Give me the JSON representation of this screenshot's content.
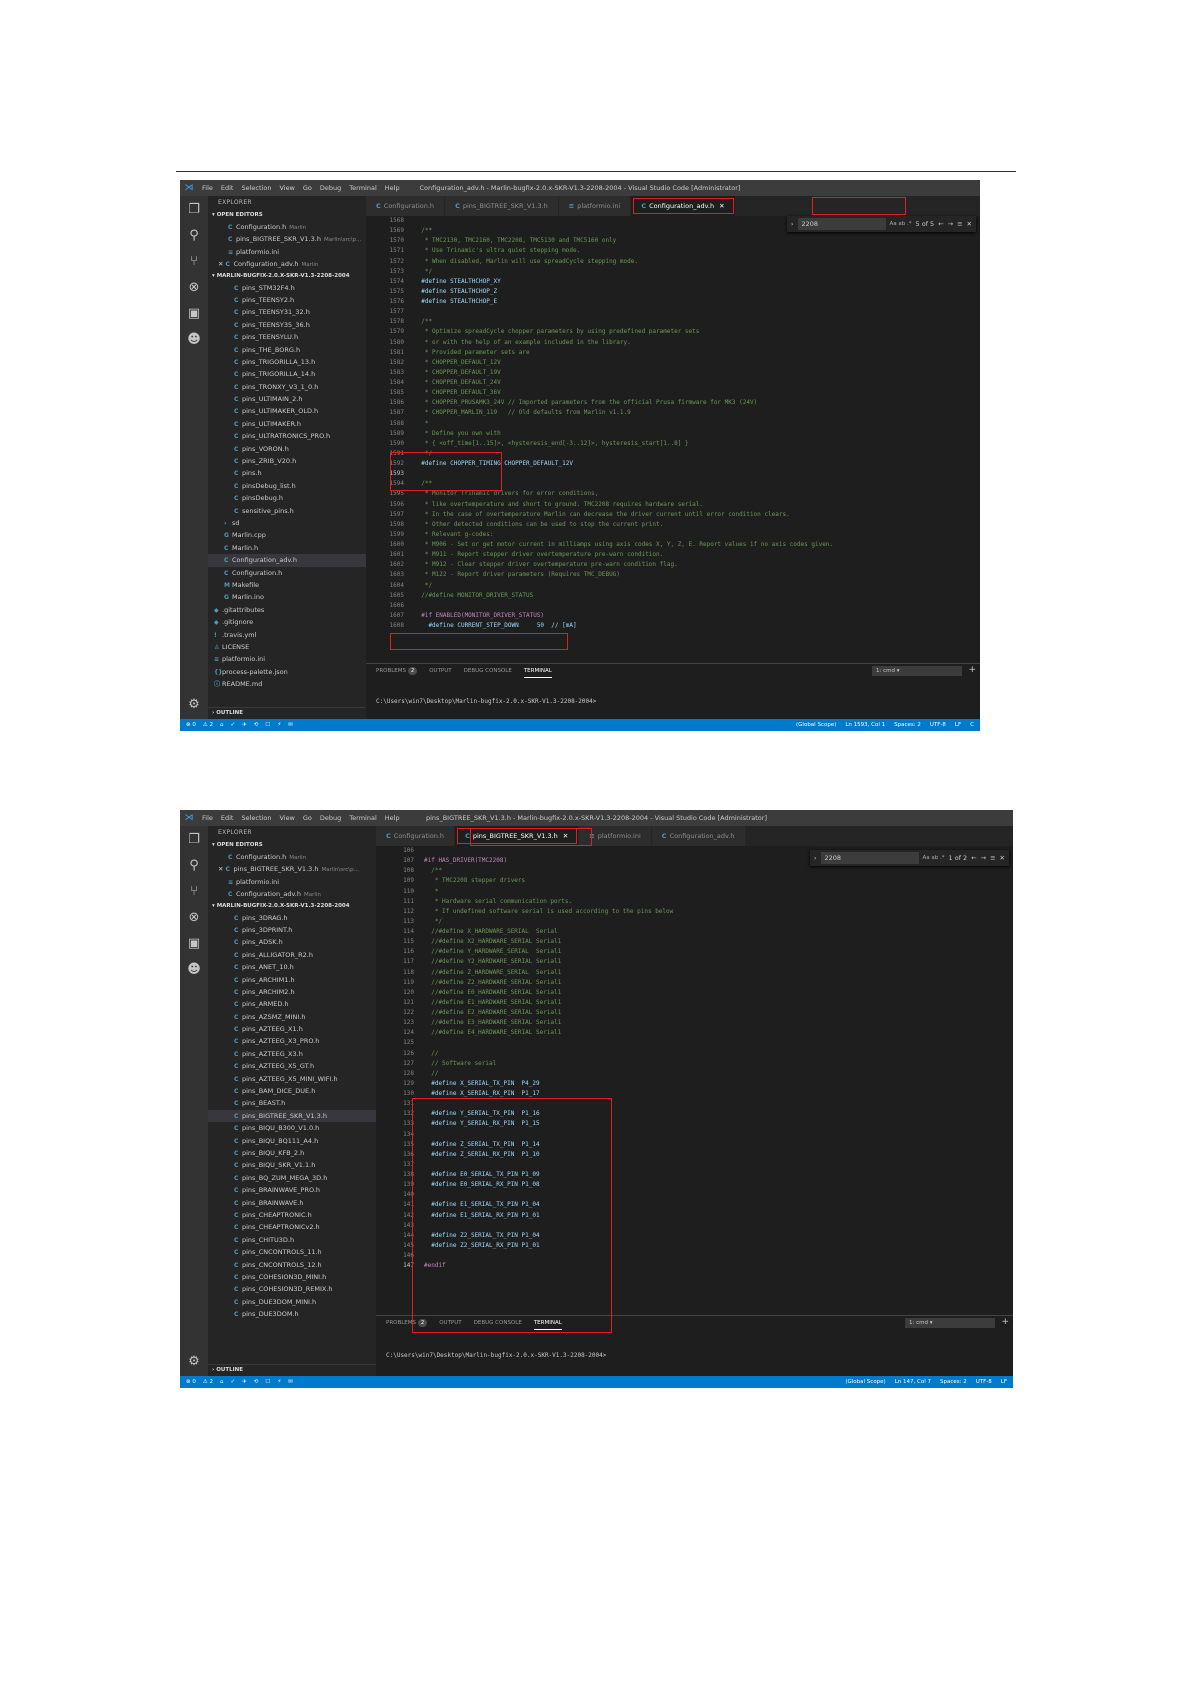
{
  "common": {
    "menu": [
      "File",
      "Edit",
      "Selection",
      "View",
      "Go",
      "Debug",
      "Terminal",
      "Help"
    ],
    "explorer_title": "EXPLORER",
    "open_editors_label": "OPEN EDITORS",
    "workspace_label": "MARLIN-BUGFIX-2.0.X-SKR-V1.3-2208-2004",
    "outline_label": "OUTLINE",
    "panel_tabs": [
      "PROBLEMS",
      "OUTPUT",
      "DEBUG CONSOLE",
      "TERMINAL"
    ],
    "problems_count": "2",
    "terminal_select": "1: cmd",
    "status_left": [
      "⊗ 0",
      "⚠ 2"
    ],
    "accent": "#007acc",
    "highlight_color": "#e02020"
  },
  "shot1": {
    "window_title": "Configuration_adv.h - Marlin-bugfix-2.0.x-SKR-V1.3-2208-2004 - Visual Studio Code [Administrator]",
    "tabs": [
      {
        "icon": "C",
        "label": "Configuration.h"
      },
      {
        "icon": "C",
        "label": "pins_BIGTREE_SKR_V1.3.h"
      },
      {
        "icon": "≡",
        "label": "platformio.ini"
      },
      {
        "icon": "C",
        "label": "Configuration_adv.h",
        "active": true
      }
    ],
    "open_editors": [
      {
        "icon": "C",
        "name": "Configuration.h",
        "hint": "Marlin"
      },
      {
        "icon": "C",
        "name": "pins_BIGTREE_SKR_V1.3.h",
        "hint": "Marlin\\src\\p..."
      },
      {
        "icon": "≡",
        "name": "platformio.ini",
        "hint": ""
      },
      {
        "icon": "C",
        "name": "Configuration_adv.h",
        "hint": "Marlin",
        "close": true
      }
    ],
    "files": [
      {
        "icon": "C",
        "name": "pins_STM32F4.h",
        "indent": 2
      },
      {
        "icon": "C",
        "name": "pins_TEENSY2.h",
        "indent": 2
      },
      {
        "icon": "C",
        "name": "pins_TEENSY31_32.h",
        "indent": 2
      },
      {
        "icon": "C",
        "name": "pins_TEENSY35_36.h",
        "indent": 2
      },
      {
        "icon": "C",
        "name": "pins_TEENSYLU.h",
        "indent": 2
      },
      {
        "icon": "C",
        "name": "pins_THE_BORG.h",
        "indent": 2
      },
      {
        "icon": "C",
        "name": "pins_TRIGORILLA_13.h",
        "indent": 2
      },
      {
        "icon": "C",
        "name": "pins_TRIGORILLA_14.h",
        "indent": 2
      },
      {
        "icon": "C",
        "name": "pins_TRONXY_V3_1_0.h",
        "indent": 2
      },
      {
        "icon": "C",
        "name": "pins_ULTIMAIN_2.h",
        "indent": 2
      },
      {
        "icon": "C",
        "name": "pins_ULTIMAKER_OLD.h",
        "indent": 2
      },
      {
        "icon": "C",
        "name": "pins_ULTIMAKER.h",
        "indent": 2
      },
      {
        "icon": "C",
        "name": "pins_ULTRATRONICS_PRO.h",
        "indent": 2
      },
      {
        "icon": "C",
        "name": "pins_VORON.h",
        "indent": 2
      },
      {
        "icon": "C",
        "name": "pins_ZRIB_V20.h",
        "indent": 2
      },
      {
        "icon": "C",
        "name": "pins.h",
        "indent": 2
      },
      {
        "icon": "C",
        "name": "pinsDebug_list.h",
        "indent": 2
      },
      {
        "icon": "C",
        "name": "pinsDebug.h",
        "indent": 2
      },
      {
        "icon": "C",
        "name": "sensitive_pins.h",
        "indent": 2
      },
      {
        "icon": "›",
        "name": "sd",
        "indent": 1
      },
      {
        "icon": "G",
        "name": "Marlin.cpp",
        "indent": 1
      },
      {
        "icon": "C",
        "name": "Marlin.h",
        "indent": 1
      },
      {
        "icon": "C",
        "name": "Configuration_adv.h",
        "indent": 1,
        "sel": true
      },
      {
        "icon": "C",
        "name": "Configuration.h",
        "indent": 1
      },
      {
        "icon": "M",
        "name": "Makefile",
        "indent": 1
      },
      {
        "icon": "G",
        "name": "Marlin.ino",
        "indent": 1
      },
      {
        "icon": "◆",
        "name": ".gitattributes",
        "indent": 0
      },
      {
        "icon": "◆",
        "name": ".gitignore",
        "indent": 0
      },
      {
        "icon": "!",
        "name": ".travis.yml",
        "indent": 0
      },
      {
        "icon": "♙",
        "name": "LICENSE",
        "indent": 0
      },
      {
        "icon": "≡",
        "name": "platformio.ini",
        "indent": 0
      },
      {
        "icon": "{}",
        "name": "process-palette.json",
        "indent": 0
      },
      {
        "icon": "ⓘ",
        "name": "README.md",
        "indent": 0
      }
    ],
    "find": {
      "value": "2208",
      "result": "5 of 5",
      "opts": "Aa  ab  .*"
    },
    "code": [
      {
        "n": "1568",
        "t": ""
      },
      {
        "n": "1569",
        "t": "  /**"
      },
      {
        "n": "1570",
        "t": "   * TMC2130, TMC2160, TMC2208, TMC5130 and TMC5160 only"
      },
      {
        "n": "1571",
        "t": "   * Use Trinamic's ultra quiet stepping mode."
      },
      {
        "n": "1572",
        "t": "   * When disabled, Marlin will use spreadCycle stepping mode."
      },
      {
        "n": "1573",
        "t": "   */"
      },
      {
        "n": "1574",
        "t": "  #define STEALTHCHOP_XY",
        "k": "def"
      },
      {
        "n": "1575",
        "t": "  #define STEALTHCHOP_Z",
        "k": "def"
      },
      {
        "n": "1576",
        "t": "  #define STEALTHCHOP_E",
        "k": "def"
      },
      {
        "n": "1577",
        "t": ""
      },
      {
        "n": "1578",
        "t": "  /**"
      },
      {
        "n": "1579",
        "t": "   * Optimize spreadCycle chopper parameters by using predefined parameter sets"
      },
      {
        "n": "1580",
        "t": "   * or with the help of an example included in the library."
      },
      {
        "n": "1581",
        "t": "   * Provided parameter sets are"
      },
      {
        "n": "1582",
        "t": "   * CHOPPER_DEFAULT_12V"
      },
      {
        "n": "1583",
        "t": "   * CHOPPER_DEFAULT_19V"
      },
      {
        "n": "1584",
        "t": "   * CHOPPER_DEFAULT_24V"
      },
      {
        "n": "1585",
        "t": "   * CHOPPER_DEFAULT_36V"
      },
      {
        "n": "1586",
        "t": "   * CHOPPER_PRUSAMK3_24V // Imported parameters from the official Prusa firmware for MK3 (24V)"
      },
      {
        "n": "1587",
        "t": "   * CHOPPER_MARLIN_119   // Old defaults from Marlin v1.1.9"
      },
      {
        "n": "1588",
        "t": "   *"
      },
      {
        "n": "1589",
        "t": "   * Define you own with"
      },
      {
        "n": "1590",
        "t": "   * { <off_time[1..15]>, <hysteresis_end[-3..12]>, hysteresis_start[1..8] }"
      },
      {
        "n": "1591",
        "t": "   */"
      },
      {
        "n": "1592",
        "t": "  #define CHOPPER_TIMING CHOPPER_DEFAULT_12V",
        "k": "def"
      },
      {
        "n": "1593",
        "t": "",
        "cur": true
      },
      {
        "n": "1594",
        "t": "  /**"
      },
      {
        "n": "1595",
        "t": "   * Monitor Trinamic drivers for error conditions,"
      },
      {
        "n": "1596",
        "t": "   * like overtemperature and short to ground. TMC2208 requires hardware serial."
      },
      {
        "n": "1597",
        "t": "   * In the case of overtemperature Marlin can decrease the driver current until error condition clears."
      },
      {
        "n": "1598",
        "t": "   * Other detected conditions can be used to stop the current print."
      },
      {
        "n": "1599",
        "t": "   * Relevant g-codes:"
      },
      {
        "n": "1600",
        "t": "   * M906 - Set or get motor current in milliamps using axis codes X, Y, Z, E. Report values if no axis codes given."
      },
      {
        "n": "1601",
        "t": "   * M911 - Report stepper driver overtemperature pre-warn condition."
      },
      {
        "n": "1602",
        "t": "   * M912 - Clear stepper driver overtemperature pre-warn condition flag."
      },
      {
        "n": "1603",
        "t": "   * M122 - Report driver parameters (Requires TMC_DEBUG)"
      },
      {
        "n": "1604",
        "t": "   */"
      },
      {
        "n": "1605",
        "t": "  //#define MONITOR_DRIVER_STATUS"
      },
      {
        "n": "1606",
        "t": ""
      },
      {
        "n": "1607",
        "t": "  #if ENABLED(MONITOR_DRIVER_STATUS)",
        "k": "pp"
      },
      {
        "n": "1608",
        "t": "    #define CURRENT_STEP_DOWN     50  // [mA]",
        "k": "def"
      }
    ],
    "terminal_line": "C:\\Users\\win7\\Desktop\\Marlin-bugfix-2.0.x-SKR-V1.3-2208-2004>",
    "status_right": [
      "(Global Scope)",
      "Ln 1593, Col 1",
      "Spaces: 2",
      "UTF-8",
      "LF",
      "C"
    ]
  },
  "shot2": {
    "window_title": "pins_BIGTREE_SKR_V1.3.h - Marlin-bugfix-2.0.x-SKR-V1.3-2208-2004 - Visual Studio Code [Administrator]",
    "tabs": [
      {
        "icon": "C",
        "label": "Configuration.h"
      },
      {
        "icon": "C",
        "label": "pins_BIGTREE_SKR_V1.3.h",
        "active": true
      },
      {
        "icon": "≡",
        "label": "platformio.ini"
      },
      {
        "icon": "C",
        "label": "Configuration_adv.h"
      }
    ],
    "open_editors": [
      {
        "icon": "C",
        "name": "Configuration.h",
        "hint": "Marlin"
      },
      {
        "icon": "C",
        "name": "pins_BIGTREE_SKR_V1.3.h",
        "hint": "Marlin\\src\\p...",
        "close": true
      },
      {
        "icon": "≡",
        "name": "platformio.ini",
        "hint": ""
      },
      {
        "icon": "C",
        "name": "Configuration_adv.h",
        "hint": "Marlin"
      }
    ],
    "files": [
      {
        "icon": "C",
        "name": "pins_3DRAG.h",
        "indent": 2
      },
      {
        "icon": "C",
        "name": "pins_3DPRINT.h",
        "indent": 2
      },
      {
        "icon": "C",
        "name": "pins_ADSK.h",
        "indent": 2
      },
      {
        "icon": "C",
        "name": "pins_ALLIGATOR_R2.h",
        "indent": 2
      },
      {
        "icon": "C",
        "name": "pins_ANET_10.h",
        "indent": 2
      },
      {
        "icon": "C",
        "name": "pins_ARCHIM1.h",
        "indent": 2
      },
      {
        "icon": "C",
        "name": "pins_ARCHIM2.h",
        "indent": 2
      },
      {
        "icon": "C",
        "name": "pins_ARMED.h",
        "indent": 2
      },
      {
        "icon": "C",
        "name": "pins_AZSMZ_MINI.h",
        "indent": 2
      },
      {
        "icon": "C",
        "name": "pins_AZTEEG_X1.h",
        "indent": 2
      },
      {
        "icon": "C",
        "name": "pins_AZTEEG_X3_PRO.h",
        "indent": 2
      },
      {
        "icon": "C",
        "name": "pins_AZTEEG_X3.h",
        "indent": 2
      },
      {
        "icon": "C",
        "name": "pins_AZTEEG_X5_GT.h",
        "indent": 2
      },
      {
        "icon": "C",
        "name": "pins_AZTEEG_X5_MINI_WIFI.h",
        "indent": 2
      },
      {
        "icon": "C",
        "name": "pins_BAM_DICE_DUE.h",
        "indent": 2
      },
      {
        "icon": "C",
        "name": "pins_BEAST.h",
        "indent": 2
      },
      {
        "icon": "C",
        "name": "pins_BIGTREE_SKR_V1.3.h",
        "indent": 2,
        "sel": true
      },
      {
        "icon": "C",
        "name": "pins_BIQU_B300_V1.0.h",
        "indent": 2
      },
      {
        "icon": "C",
        "name": "pins_BIQU_BQ111_A4.h",
        "indent": 2
      },
      {
        "icon": "C",
        "name": "pins_BIQU_KFB_2.h",
        "indent": 2
      },
      {
        "icon": "C",
        "name": "pins_BIQU_SKR_V1.1.h",
        "indent": 2
      },
      {
        "icon": "C",
        "name": "pins_BQ_ZUM_MEGA_3D.h",
        "indent": 2
      },
      {
        "icon": "C",
        "name": "pins_BRAINWAVE_PRO.h",
        "indent": 2
      },
      {
        "icon": "C",
        "name": "pins_BRAINWAVE.h",
        "indent": 2
      },
      {
        "icon": "C",
        "name": "pins_CHEAPTRONIC.h",
        "indent": 2
      },
      {
        "icon": "C",
        "name": "pins_CHEAPTRONICv2.h",
        "indent": 2
      },
      {
        "icon": "C",
        "name": "pins_CHITU3D.h",
        "indent": 2
      },
      {
        "icon": "C",
        "name": "pins_CNCONTROLS_11.h",
        "indent": 2
      },
      {
        "icon": "C",
        "name": "pins_CNCONTROLS_12.h",
        "indent": 2
      },
      {
        "icon": "C",
        "name": "pins_COHESION3D_MINI.h",
        "indent": 2
      },
      {
        "icon": "C",
        "name": "pins_COHESION3D_REMIX.h",
        "indent": 2
      },
      {
        "icon": "C",
        "name": "pins_DUE3DOM_MINI.h",
        "indent": 2
      },
      {
        "icon": "C",
        "name": "pins_DUE3DOM.h",
        "indent": 2
      }
    ],
    "find": {
      "value": "2208",
      "result": "1 of 2",
      "opts": "Aa  ab  .*"
    },
    "code": [
      {
        "n": "106",
        "t": ""
      },
      {
        "n": "107",
        "t": "#if HAS_DRIVER(TMC2208)",
        "k": "pp"
      },
      {
        "n": "108",
        "t": "  /**"
      },
      {
        "n": "109",
        "t": "   * TMC2208 stepper drivers"
      },
      {
        "n": "110",
        "t": "   *"
      },
      {
        "n": "111",
        "t": "   * Hardware serial communication ports."
      },
      {
        "n": "112",
        "t": "   * If undefined software serial is used according to the pins below"
      },
      {
        "n": "113",
        "t": "   */"
      },
      {
        "n": "114",
        "t": "  //#define X_HARDWARE_SERIAL  Serial"
      },
      {
        "n": "115",
        "t": "  //#define X2_HARDWARE_SERIAL Serial1"
      },
      {
        "n": "116",
        "t": "  //#define Y_HARDWARE_SERIAL  Serial1"
      },
      {
        "n": "117",
        "t": "  //#define Y2_HARDWARE_SERIAL Serial1"
      },
      {
        "n": "118",
        "t": "  //#define Z_HARDWARE_SERIAL  Serial1"
      },
      {
        "n": "119",
        "t": "  //#define Z2_HARDWARE_SERIAL Serial1"
      },
      {
        "n": "120",
        "t": "  //#define E0_HARDWARE_SERIAL Serial1"
      },
      {
        "n": "121",
        "t": "  //#define E1_HARDWARE_SERIAL Serial1"
      },
      {
        "n": "122",
        "t": "  //#define E2_HARDWARE_SERIAL Serial1"
      },
      {
        "n": "123",
        "t": "  //#define E3_HARDWARE_SERIAL Serial1"
      },
      {
        "n": "124",
        "t": "  //#define E4_HARDWARE_SERIAL Serial1"
      },
      {
        "n": "125",
        "t": ""
      },
      {
        "n": "126",
        "t": "  //"
      },
      {
        "n": "127",
        "t": "  // Software serial"
      },
      {
        "n": "128",
        "t": "  //"
      },
      {
        "n": "129",
        "t": "  #define X_SERIAL_TX_PIN  P4_29",
        "k": "def"
      },
      {
        "n": "130",
        "t": "  #define X_SERIAL_RX_PIN  P1_17",
        "k": "def"
      },
      {
        "n": "131",
        "t": ""
      },
      {
        "n": "132",
        "t": "  #define Y_SERIAL_TX_PIN  P1_16",
        "k": "def"
      },
      {
        "n": "133",
        "t": "  #define Y_SERIAL_RX_PIN  P1_15",
        "k": "def"
      },
      {
        "n": "134",
        "t": ""
      },
      {
        "n": "135",
        "t": "  #define Z_SERIAL_TX_PIN  P1_14",
        "k": "def"
      },
      {
        "n": "136",
        "t": "  #define Z_SERIAL_RX_PIN  P1_10",
        "k": "def"
      },
      {
        "n": "137",
        "t": ""
      },
      {
        "n": "138",
        "t": "  #define E0_SERIAL_TX_PIN P1_09",
        "k": "def"
      },
      {
        "n": "139",
        "t": "  #define E0_SERIAL_RX_PIN P1_08",
        "k": "def"
      },
      {
        "n": "140",
        "t": ""
      },
      {
        "n": "141",
        "t": "  #define E1_SERIAL_TX_PIN P1_04",
        "k": "def"
      },
      {
        "n": "142",
        "t": "  #define E1_SERIAL_RX_PIN P1_01",
        "k": "def"
      },
      {
        "n": "143",
        "t": ""
      },
      {
        "n": "144",
        "t": "  #define Z2_SERIAL_TX_PIN P1_04",
        "k": "def"
      },
      {
        "n": "145",
        "t": "  #define Z2_SERIAL_RX_PIN P1_01",
        "k": "def"
      },
      {
        "n": "146",
        "t": ""
      },
      {
        "n": "147",
        "t": "#endif",
        "k": "pp",
        "cur": true
      }
    ],
    "terminal_line": "C:\\Users\\win7\\Desktop\\Marlin-bugfix-2.0.x-SKR-V1.3-2208-2004>",
    "status_right": [
      "(Global Scope)",
      "Ln 147, Col 7",
      "Spaces: 2",
      "UTF-8",
      "LF"
    ]
  }
}
